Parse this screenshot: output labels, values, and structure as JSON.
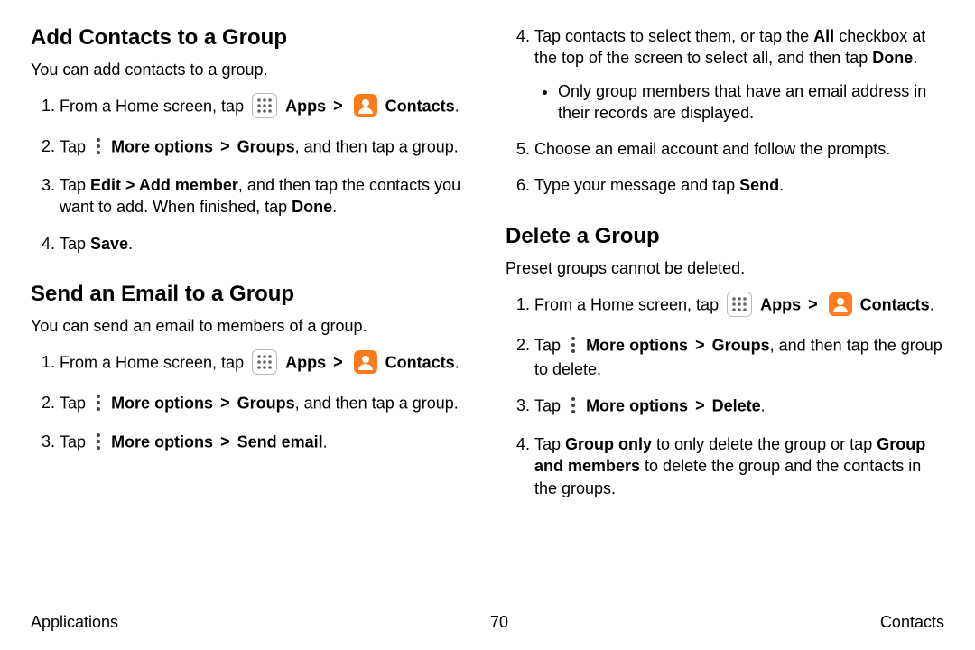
{
  "footer": {
    "left": "Applications",
    "page": "70",
    "right": "Contacts"
  },
  "icons": {
    "apps_label": "Apps",
    "contacts_label": "Contacts",
    "more_label": "More options"
  },
  "left": {
    "sec1": {
      "heading": "Add Contacts to a Group",
      "intro": "You can add contacts to a group.",
      "step1_a": "From a Home screen, tap",
      "step1_apps": "Apps",
      "step1_sep": ">",
      "step1_contacts": "Contacts",
      "step1_end": ".",
      "step2_a": "Tap",
      "step2_more": "More options",
      "step2_sep": ">",
      "step2_groups": "Groups",
      "step2_end": ", and then tap a group.",
      "step3_a": "Tap ",
      "step3_edit": "Edit",
      "step3_sep": " > ",
      "step3_addmember": "Add member",
      "step3_mid": ", and then tap the contacts you want to add. When finished, tap ",
      "step3_done": "Done",
      "step3_end": ".",
      "step4_a": "Tap ",
      "step4_save": "Save",
      "step4_end": "."
    },
    "sec2": {
      "heading": "Send an Email to a Group",
      "intro": "You can send an email to members of a group.",
      "step1_a": "From a Home screen, tap",
      "step1_apps": "Apps",
      "step1_sep": ">",
      "step1_contacts": "Contacts",
      "step1_end": ".",
      "step2_a": "Tap",
      "step2_more": "More options",
      "step2_sep": ">",
      "step2_groups": "Groups",
      "step2_end": ", and then tap a group.",
      "step3_a": "Tap",
      "step3_more": "More options",
      "step3_sep": ">",
      "step3_sendemail": "Send email",
      "step3_end": "."
    }
  },
  "right": {
    "sec2_cont": {
      "step4_a": "Tap contacts to select them, or tap the ",
      "step4_all": "All",
      "step4_b": " checkbox at the top of the screen to select all, and then tap ",
      "step4_done": "Done",
      "step4_end": ".",
      "bullet1": "Only group members that have an email address in their records are displayed.",
      "step5": "Choose an email account and follow the prompts.",
      "step6_a": "Type your message and tap ",
      "step6_send": "Send",
      "step6_end": "."
    },
    "sec3": {
      "heading": "Delete a Group",
      "intro": "Preset groups cannot be deleted.",
      "step1_a": "From a Home screen, tap",
      "step1_apps": "Apps",
      "step1_sep": ">",
      "step1_contacts": "Contacts",
      "step1_end": ".",
      "step2_a": "Tap",
      "step2_more": "More options",
      "step2_sep": ">",
      "step2_groups": "Groups",
      "step2_end": ", and then tap the group to delete.",
      "step3_a": "Tap",
      "step3_more": "More options",
      "step3_sep": ">",
      "step3_delete": "Delete",
      "step3_end": ".",
      "step4_a": "Tap ",
      "step4_grouponly": "Group only",
      "step4_b": " to only delete the group or tap ",
      "step4_groupandmembers": "Group and members",
      "step4_c": " to delete the group and the contacts in the groups."
    }
  }
}
